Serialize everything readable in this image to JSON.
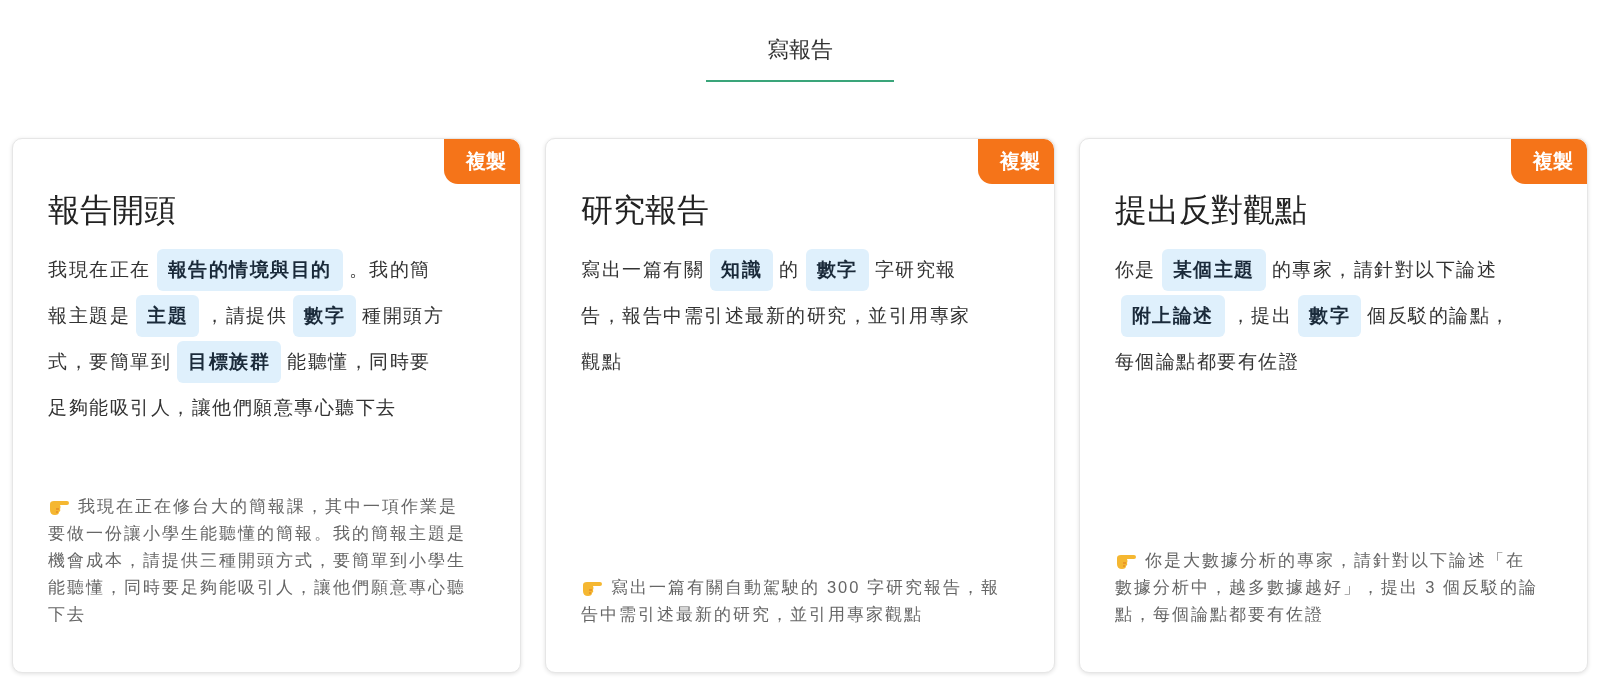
{
  "tabs": [
    {
      "label": "寫報告",
      "selected": true
    }
  ],
  "cards": [
    {
      "copy_button": "複製",
      "title": "報告開頭",
      "prompt_lines": [
        [
          {
            "kind": "text",
            "text": "我現在正在"
          },
          {
            "kind": "slot",
            "text": "報告的情境與目的"
          },
          {
            "kind": "text",
            "text": "。我的簡"
          }
        ],
        [
          {
            "kind": "text",
            "text": "報主題是"
          },
          {
            "kind": "slot",
            "text": "主題"
          },
          {
            "kind": "text",
            "text": "，請提供"
          },
          {
            "kind": "slot",
            "text": "數字"
          },
          {
            "kind": "text",
            "text": "種開頭方"
          }
        ],
        [
          {
            "kind": "text",
            "text": "式，要簡單到"
          },
          {
            "kind": "slot",
            "text": "目標族群"
          },
          {
            "kind": "text",
            "text": "能聽懂，同時要"
          }
        ],
        [
          {
            "kind": "text",
            "text": "足夠能吸引人，讓他們願意專心聽下去"
          }
        ]
      ],
      "example_lines": [
        "我現在正在修台大的簡報課，其中一項作業是",
        "要做一份讓小學生能聽懂的簡報。我的簡報主題是",
        "機會成本，請提供三種開頭方式，要簡單到小學生",
        "能聽懂，同時要足夠能吸引人，讓他們願意專心聽",
        "下去"
      ]
    },
    {
      "copy_button": "複製",
      "title": "研究報告",
      "prompt_lines": [
        [
          {
            "kind": "text",
            "text": "寫出一篇有關"
          },
          {
            "kind": "slot",
            "text": "知識"
          },
          {
            "kind": "text",
            "text": "的"
          },
          {
            "kind": "slot",
            "text": "數字"
          },
          {
            "kind": "text",
            "text": "字研究報"
          }
        ],
        [
          {
            "kind": "text",
            "text": "告，報告中需引述最新的研究，並引用專家"
          }
        ],
        [
          {
            "kind": "text",
            "text": "觀點"
          }
        ]
      ],
      "example_lines": [
        "寫出一篇有關自動駕駛的 300 字研究報告，報",
        "告中需引述最新的研究，並引用專家觀點"
      ]
    },
    {
      "copy_button": "複製",
      "title": "提出反對觀點",
      "prompt_lines": [
        [
          {
            "kind": "text",
            "text": "你是"
          },
          {
            "kind": "slot",
            "text": "某個主題"
          },
          {
            "kind": "text",
            "text": "的專家，請針對以下論述"
          }
        ],
        [
          {
            "kind": "slot",
            "text": "附上論述"
          },
          {
            "kind": "text",
            "text": "，提出"
          },
          {
            "kind": "slot",
            "text": "數字"
          },
          {
            "kind": "text",
            "text": "個反駁的論點，"
          }
        ],
        [
          {
            "kind": "text",
            "text": "每個論點都要有佐證"
          }
        ]
      ],
      "example_lines": [
        "你是大數據分析的專家，請針對以下論述「在",
        "數據分析中，越多數據越好」，提出 3 個反駁的論",
        "點，每個論點都要有佐證"
      ]
    }
  ]
}
